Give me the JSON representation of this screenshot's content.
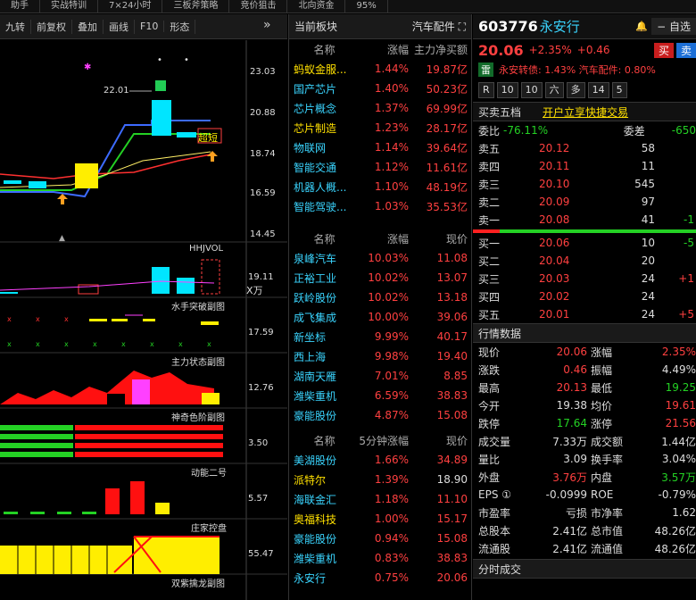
{
  "topbar": [
    "助手",
    "实战特训",
    "7×24小时",
    "三板斧策略",
    "竞价狙击",
    "北向资金",
    "95%"
  ],
  "toolbar": {
    "items": [
      "九转",
      "前复权",
      "叠加",
      "画线",
      "F10",
      "形态"
    ]
  },
  "kline": {
    "prices": [
      "23.03",
      "20.88",
      "18.74",
      "16.59",
      "14.45"
    ],
    "mark_22": "22.01",
    "short_label": "超短",
    "volume_title": "HHJVOL",
    "vol_value": "19.11",
    "vol_unit": "X万"
  },
  "indicators": [
    {
      "name": "水手突破副图",
      "value": "17.59"
    },
    {
      "name": "主力状态副图",
      "value": "12.76"
    },
    {
      "name": "神奇色阶副图",
      "value": "3.50"
    },
    {
      "name": "动能二号",
      "value": "5.57"
    },
    {
      "name": "庄家控盘",
      "value": "55.47"
    },
    {
      "name": "双紫擒龙副图",
      "value": ""
    }
  ],
  "sector_panel": {
    "title": "当前板块",
    "sector": "汽车配件",
    "hdr1": [
      "名称",
      "涨幅",
      "主力净买额"
    ],
    "rows1": [
      [
        "蚂蚁金服...",
        "1.44%",
        "19.87亿"
      ],
      [
        "国产芯片",
        "1.40%",
        "50.23亿"
      ],
      [
        "芯片概念",
        "1.37%",
        "69.99亿"
      ],
      [
        "芯片制造",
        "1.23%",
        "28.17亿"
      ],
      [
        "物联网",
        "1.14%",
        "39.64亿"
      ],
      [
        "智能交通",
        "1.12%",
        "11.61亿"
      ],
      [
        "机器人概...",
        "1.10%",
        "48.19亿"
      ],
      [
        "智能驾驶...",
        "1.03%",
        "35.53亿"
      ]
    ],
    "hdr2": [
      "名称",
      "涨幅",
      "现价"
    ],
    "rows2": [
      [
        "泉峰汽车",
        "10.03%",
        "11.08"
      ],
      [
        "正裕工业",
        "10.02%",
        "13.07"
      ],
      [
        "跃岭股份",
        "10.02%",
        "13.18"
      ],
      [
        "成飞集成",
        "10.00%",
        "39.06"
      ],
      [
        "新坐标",
        "9.99%",
        "40.17"
      ],
      [
        "西上海",
        "9.98%",
        "19.40"
      ],
      [
        "湖南天雁",
        "7.01%",
        "8.85"
      ],
      [
        "潍柴重机",
        "6.59%",
        "38.83"
      ],
      [
        "豪能股份",
        "4.87%",
        "15.08"
      ]
    ],
    "hdr3": [
      "名称",
      "5分钟涨幅",
      "现价"
    ],
    "rows3": [
      [
        "美湖股份",
        "1.66%",
        "34.89"
      ],
      [
        "派特尔",
        "1.39%",
        "18.90"
      ],
      [
        "海联金汇",
        "1.18%",
        "11.10"
      ],
      [
        "奥福科技",
        "1.00%",
        "15.17"
      ],
      [
        "豪能股份",
        "0.94%",
        "15.08"
      ],
      [
        "潍柴重机",
        "0.83%",
        "38.83"
      ],
      [
        "永安行",
        "0.75%",
        "20.06"
      ]
    ]
  },
  "quote": {
    "code": "603776",
    "name": "永安行",
    "self": "自选",
    "price": "20.06",
    "pct": "+2.35%",
    "chg": "+0.46",
    "buy": "买",
    "sell": "卖",
    "tags": "永安转债: 1.43% 汽车配件: 0.80%",
    "lei": "雷",
    "level_btns": [
      "R",
      "10",
      "10",
      "六",
      "多",
      "14",
      "5"
    ],
    "book_title": "买卖五档",
    "book_link": "开户立享快捷交易",
    "weibi": "-76.11%",
    "weicha": "-650",
    "asks": [
      [
        "卖五",
        "20.12",
        "58",
        ""
      ],
      [
        "卖四",
        "20.11",
        "11",
        ""
      ],
      [
        "卖三",
        "20.10",
        "545",
        ""
      ],
      [
        "卖二",
        "20.09",
        "97",
        ""
      ],
      [
        "卖一",
        "20.08",
        "41",
        "-1"
      ]
    ],
    "bids": [
      [
        "买一",
        "20.06",
        "10",
        "-5"
      ],
      [
        "买二",
        "20.04",
        "20",
        ""
      ],
      [
        "买三",
        "20.03",
        "24",
        "+1"
      ],
      [
        "买四",
        "20.02",
        "24",
        ""
      ],
      [
        "买五",
        "20.01",
        "24",
        "+5"
      ]
    ],
    "stats_title": "行情数据",
    "stats": [
      [
        "现价",
        "20.06",
        "涨幅",
        "2.35%"
      ],
      [
        "涨跌",
        "0.46",
        "振幅",
        "4.49%"
      ],
      [
        "最高",
        "20.13",
        "最低",
        "19.25"
      ],
      [
        "今开",
        "19.38",
        "均价",
        "19.61"
      ],
      [
        "跌停",
        "17.64",
        "涨停",
        "21.56"
      ],
      [
        "成交量",
        "7.33万",
        "成交额",
        "1.44亿"
      ],
      [
        "量比",
        "3.09",
        "换手率",
        "3.04%"
      ],
      [
        "外盘",
        "3.76万",
        "内盘",
        "3.57万"
      ],
      [
        "EPS ①",
        "-0.0999",
        "ROE",
        "-0.79%"
      ],
      [
        "市盈率",
        "亏损",
        "市净率",
        "1.62"
      ],
      [
        "总股本",
        "2.41亿",
        "总市值",
        "48.26亿"
      ],
      [
        "流通股",
        "2.41亿",
        "流通值",
        "48.26亿"
      ]
    ],
    "footer": "分时成交"
  }
}
